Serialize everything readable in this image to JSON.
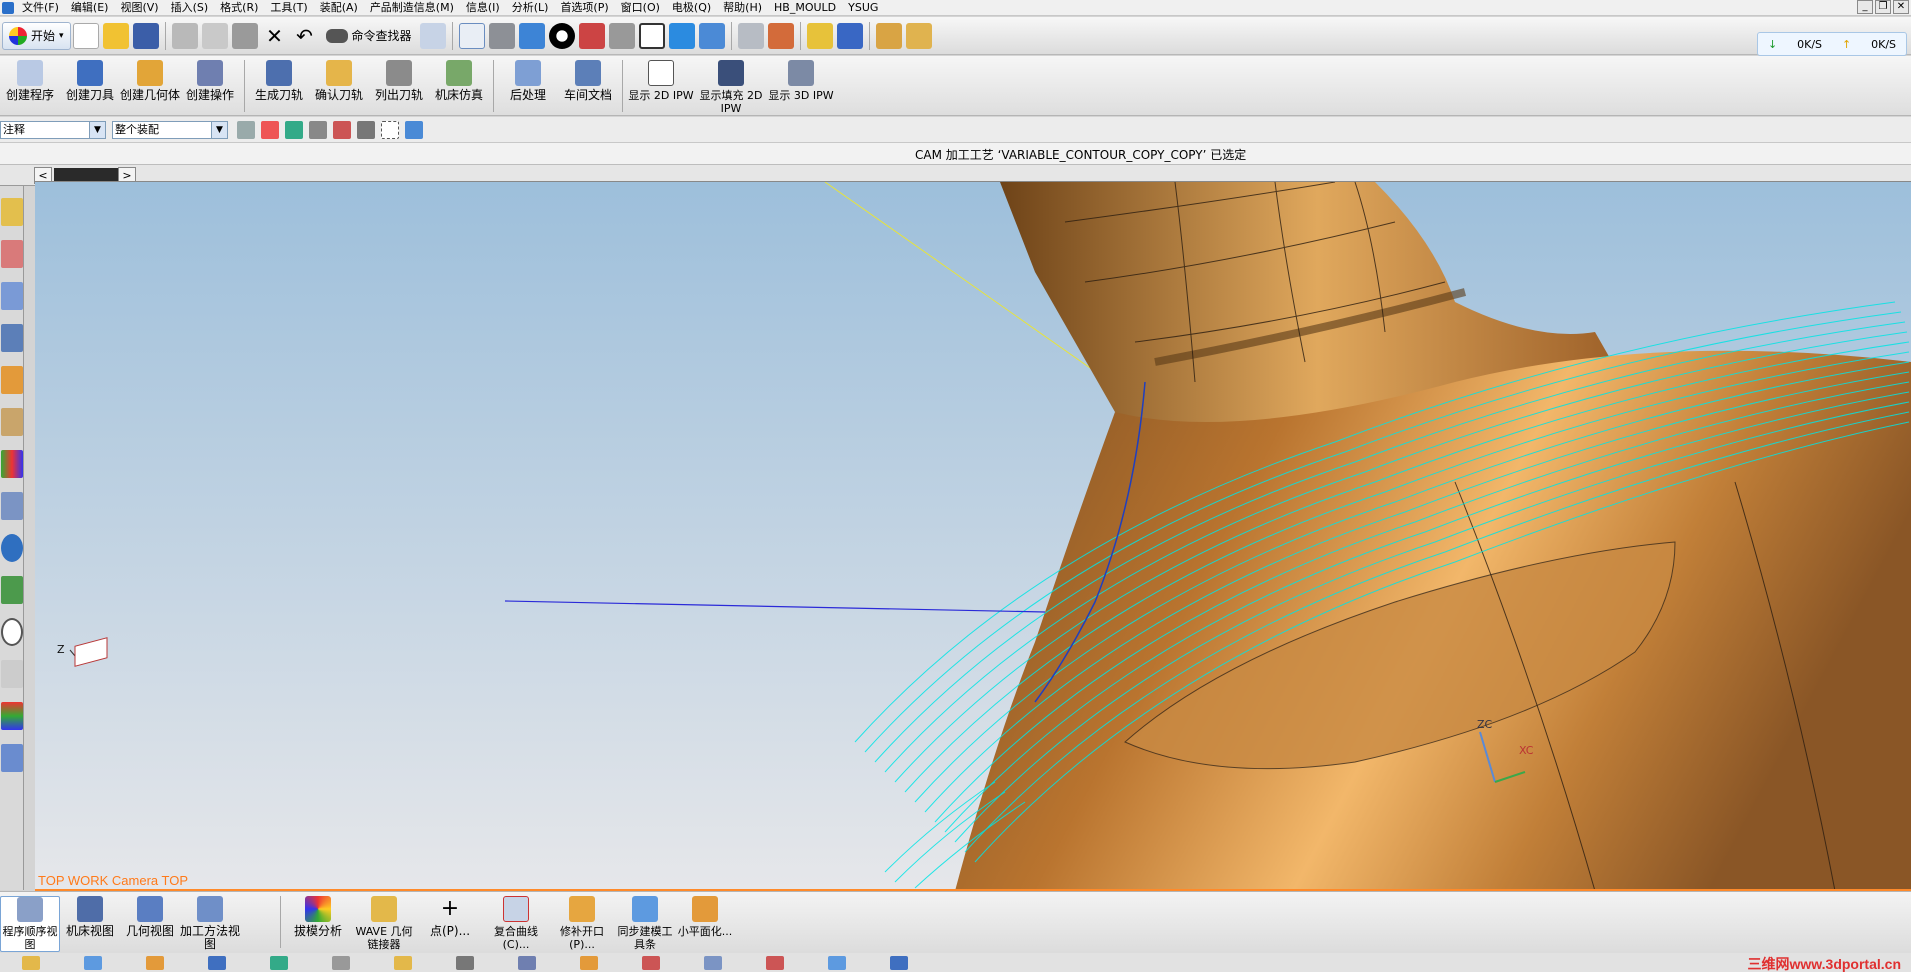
{
  "menu": [
    "文件(F)",
    "编辑(E)",
    "视图(V)",
    "插入(S)",
    "格式(R)",
    "工具(T)",
    "装配(A)",
    "产品制造信息(M)",
    "信息(I)",
    "分析(L)",
    "首选项(P)",
    "窗口(O)",
    "电极(Q)",
    "帮助(H)",
    "HB_MOULD",
    "YSUG"
  ],
  "window_controls": [
    "_",
    "❐",
    "✕"
  ],
  "toolbar": {
    "start_label": "开始",
    "command_finder_label": "命令查找器"
  },
  "network": {
    "down": "0K/S",
    "up": "0K/S"
  },
  "cam_toolbar": {
    "create_program": "创建程序",
    "create_tool": "创建刀具",
    "create_geometry": "创建几何体",
    "create_operation": "创建操作",
    "generate_path": "生成刀轨",
    "verify_path": "确认刀轨",
    "list_path": "列出刀轨",
    "machine_sim": "机床仿真",
    "postprocess": "后处理",
    "shop_doc": "车间文档",
    "show_2d_ipw": "显示 2D IPW",
    "show_fill_2d_ipw": "显示填充 2D IPW",
    "show_3d_ipw": "显示 3D IPW"
  },
  "filter": {
    "type_filter": "注释",
    "scope_filter": "整个装配"
  },
  "status": {
    "message": "CAM 加工工艺 ‘VARIABLE_CONTOUR_COPY_COPY’ 已选定"
  },
  "tabs": {
    "prev": "<",
    "next": ">"
  },
  "viewport": {
    "label": "TOP WORK Camera TOP",
    "axis_z": "Z",
    "triad_zc": "ZC",
    "triad_xc": "XC",
    "colors": {
      "toolpath": "#00e5e5",
      "part": "#c07830",
      "background_top": "#9dbfdb",
      "background_bottom": "#e6e7ea",
      "view_label": "#ff7a1a"
    }
  },
  "bottom_toolbar": {
    "program_order_view": "程序顺序视图",
    "machine_view": "机床视图",
    "geometry_view": "几何视图",
    "method_view": "加工方法视图",
    "draft_analysis": "拔模分析",
    "wave_linker": "WAVE 几何链接器",
    "point": "点(P)...",
    "composite_curve": "复合曲线(C)...",
    "patch_opening": "修补开口(P)...",
    "sync_modeling": "同步建模工具条",
    "small_face": "小平面化..."
  },
  "watermark": "三维网www.3dportal.cn"
}
